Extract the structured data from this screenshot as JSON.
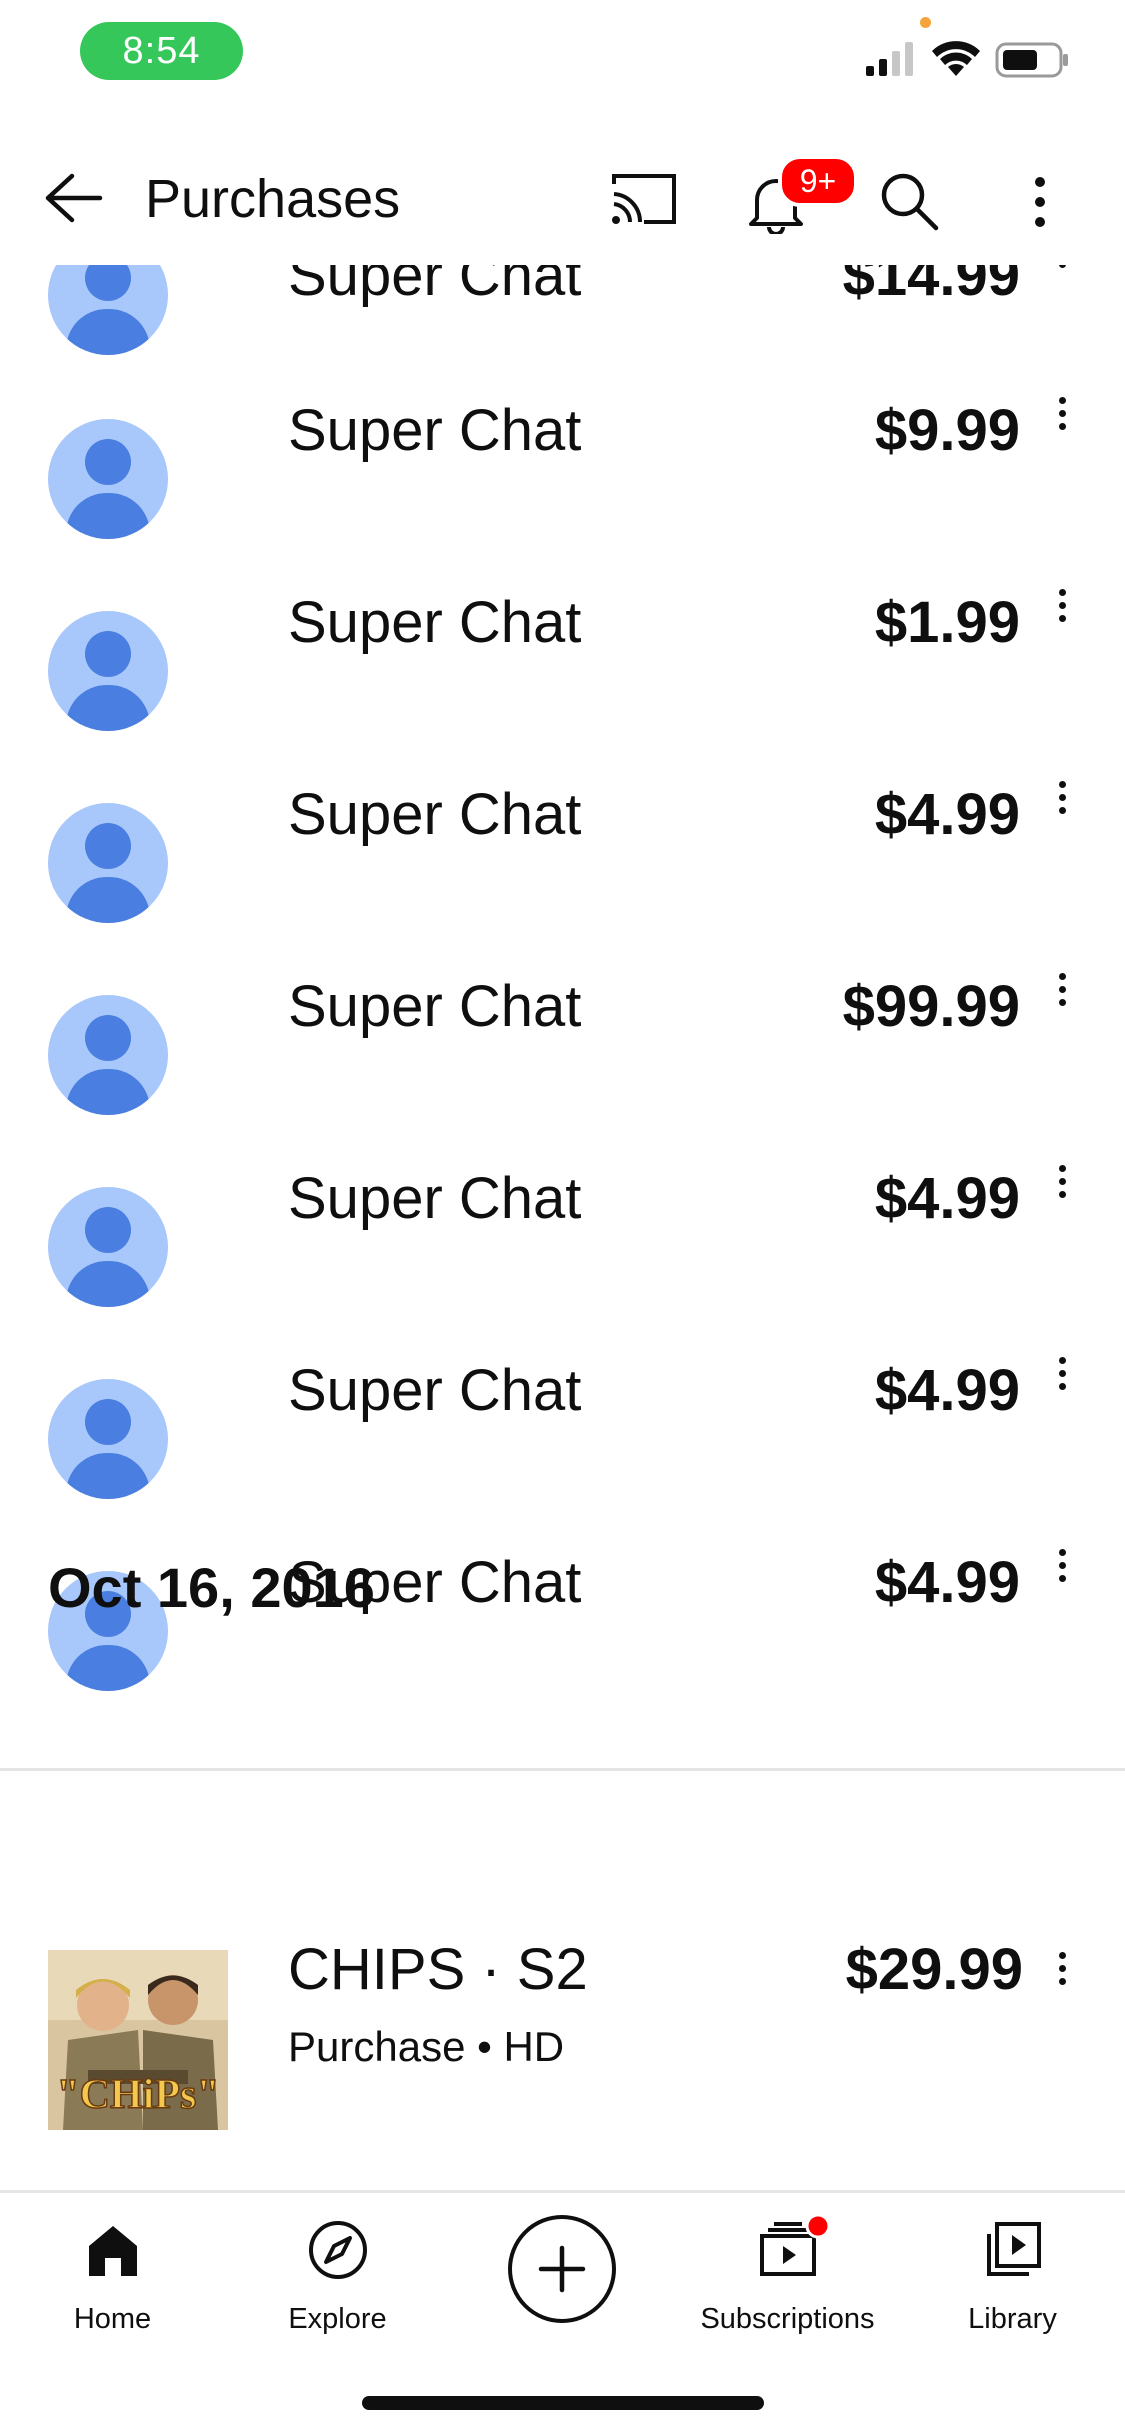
{
  "status_bar": {
    "time": "8:54"
  },
  "header": {
    "title": "Purchases",
    "notification_badge": "9+"
  },
  "purchases": [
    {
      "label": "Super Chat",
      "price": "$14.99"
    },
    {
      "label": "Super Chat",
      "price": "$9.99"
    },
    {
      "label": "Super Chat",
      "price": "$1.99"
    },
    {
      "label": "Super Chat",
      "price": "$4.99"
    },
    {
      "label": "Super Chat",
      "price": "$99.99"
    },
    {
      "label": "Super Chat",
      "price": "$4.99"
    },
    {
      "label": "Super Chat",
      "price": "$4.99"
    },
    {
      "label": "Super Chat",
      "price": "$4.99"
    }
  ],
  "section": {
    "date": "Oct 16, 2016",
    "item": {
      "title": "CHIPS · S2",
      "subtitle": "Purchase • HD",
      "price": "$29.99",
      "thumbnail_text": "\"CHiPs\""
    }
  },
  "bottom_nav": {
    "home": "Home",
    "explore": "Explore",
    "subscriptions": "Subscriptions",
    "library": "Library"
  },
  "colors": {
    "brand_red": "#ff0000",
    "status_green": "#35c759",
    "avatar_bg": "#a8c7fa",
    "avatar_fg": "#4a7ee0"
  }
}
